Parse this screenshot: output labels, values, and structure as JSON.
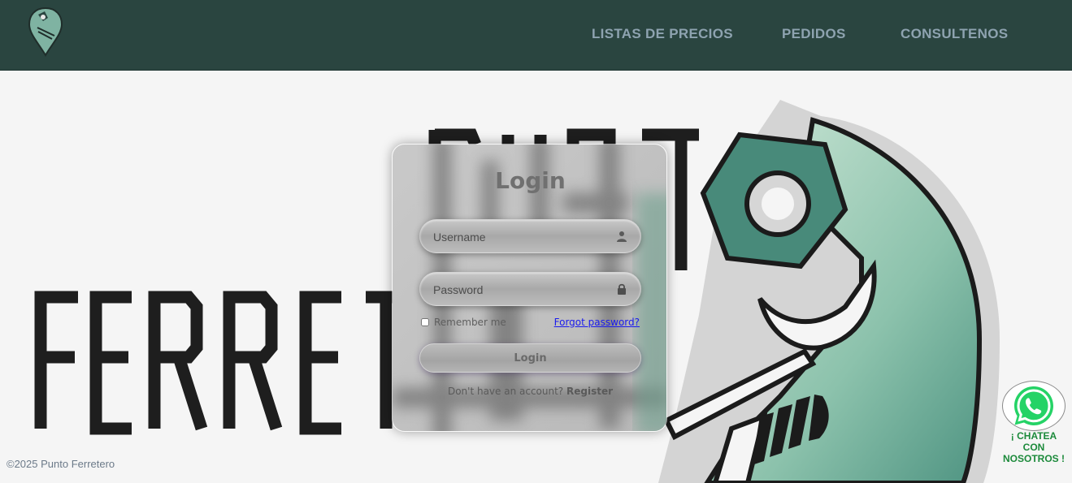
{
  "header": {
    "logo_icon": "wrench-location-pin-logo",
    "nav": [
      {
        "label": "LISTAS DE PRECIOS"
      },
      {
        "label": "PEDIDOS"
      },
      {
        "label": "CONSULTENOS"
      }
    ]
  },
  "hero": {
    "brand_word_top": "PUNT",
    "brand_word_bottom": "FERRET"
  },
  "login": {
    "title": "Login",
    "username_placeholder": "Username",
    "username_icon": "user-icon",
    "password_placeholder": "Password",
    "password_icon": "lock-icon",
    "remember_label": "Remember me",
    "forgot_label": "Forgot password?",
    "button_label": "Login",
    "register_prompt": "Don't have an account?",
    "register_link": "Register"
  },
  "footer": {
    "copyright": "©2025 Punto Ferretero"
  },
  "whatsapp": {
    "icon": "whatsapp-icon",
    "line1": "¡ CHATEA",
    "line2": "CON",
    "line3": "NOSOTROS !"
  },
  "colors": {
    "header_bg": "#2a4540",
    "nav_text": "#8ea3b0",
    "accent_teal": "#4a8878",
    "whatsapp_green": "#25d366"
  }
}
